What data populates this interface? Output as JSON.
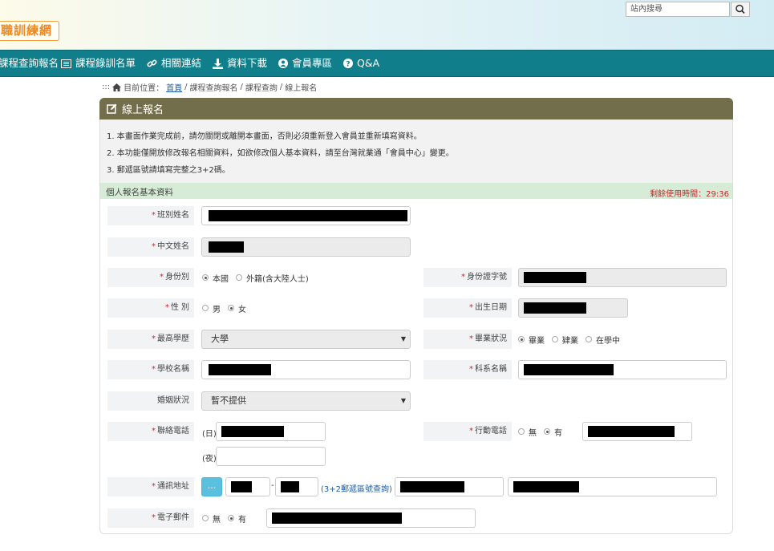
{
  "header": {
    "logo_text": "職訓練網",
    "search_placeholder": "站內搜尋"
  },
  "nav": {
    "items": [
      {
        "label": "課程查詢報名",
        "icon": "none"
      },
      {
        "label": "課程錄訓名單",
        "icon": "list-icon"
      },
      {
        "label": "相關連結",
        "icon": "link-icon"
      },
      {
        "label": "資料下載",
        "icon": "download-icon"
      },
      {
        "label": "會員專區",
        "icon": "user-icon"
      },
      {
        "label": "Q&A",
        "icon": "question-icon"
      }
    ]
  },
  "breadcrumb": {
    "prefix": ":::",
    "current_label": "目前位置：",
    "home": "首頁",
    "sep": "/",
    "path1": "課程查詢報名",
    "path2": "課程查詢",
    "path3": "線上報名"
  },
  "panel": {
    "title": "線上報名",
    "notes": [
      "1. 本畫面作業完成前，請勿關閉或離開本畫面，否則必須重新登入會員並重新填寫資料。",
      "2. 本功能僅開放修改報名相關資料，如欲修改個人基本資料，請至台灣就業通「會員中心」變更。",
      "3. 郵遞區號請填寫完整之3+2碼。"
    ],
    "section_title": "個人報名基本資料",
    "timer_label": "剩餘使用時間：",
    "timer_value": "29:36"
  },
  "form": {
    "class_name_label": "班別姓名",
    "chinese_name_label": "中文姓名",
    "identity_label": "身份別",
    "identity_options": [
      "本國",
      "外籍(含大陸人士)"
    ],
    "identity_selected": "本國",
    "id_number_label": "身份證字號",
    "gender_label": "性 別",
    "gender_options": [
      "男",
      "女"
    ],
    "gender_selected": "女",
    "birth_label": "出生日期",
    "education_label": "最高學歷",
    "education_value": "大學",
    "graduation_label": "畢業狀況",
    "graduation_options": [
      "畢業",
      "肄業",
      "在學中"
    ],
    "graduation_selected": "畢業",
    "school_label": "學校名稱",
    "department_label": "科系名稱",
    "marital_label": "婚姻狀況",
    "marital_value": "暫不提供",
    "phone_label": "聯絡電話",
    "phone_day_prefix": "(日)",
    "phone_night_prefix": "(夜)",
    "mobile_label": "行動電話",
    "mobile_options": [
      "無",
      "有"
    ],
    "mobile_selected": "有",
    "address_label": "通訊地址",
    "address_button": "...",
    "address_dash": "-",
    "zip_lookup": "(3+2郵遞區號查詢)",
    "email_label": "電子郵件",
    "email_options": [
      "無",
      "有"
    ],
    "email_selected": "有",
    "required_mark": "*"
  },
  "colors": {
    "nav_bg": "#117f8b",
    "panel_head_bg": "#726d4a",
    "section_bg": "#d6ecd6",
    "timer": "#d2232a",
    "address_button": "#5bc0de"
  }
}
